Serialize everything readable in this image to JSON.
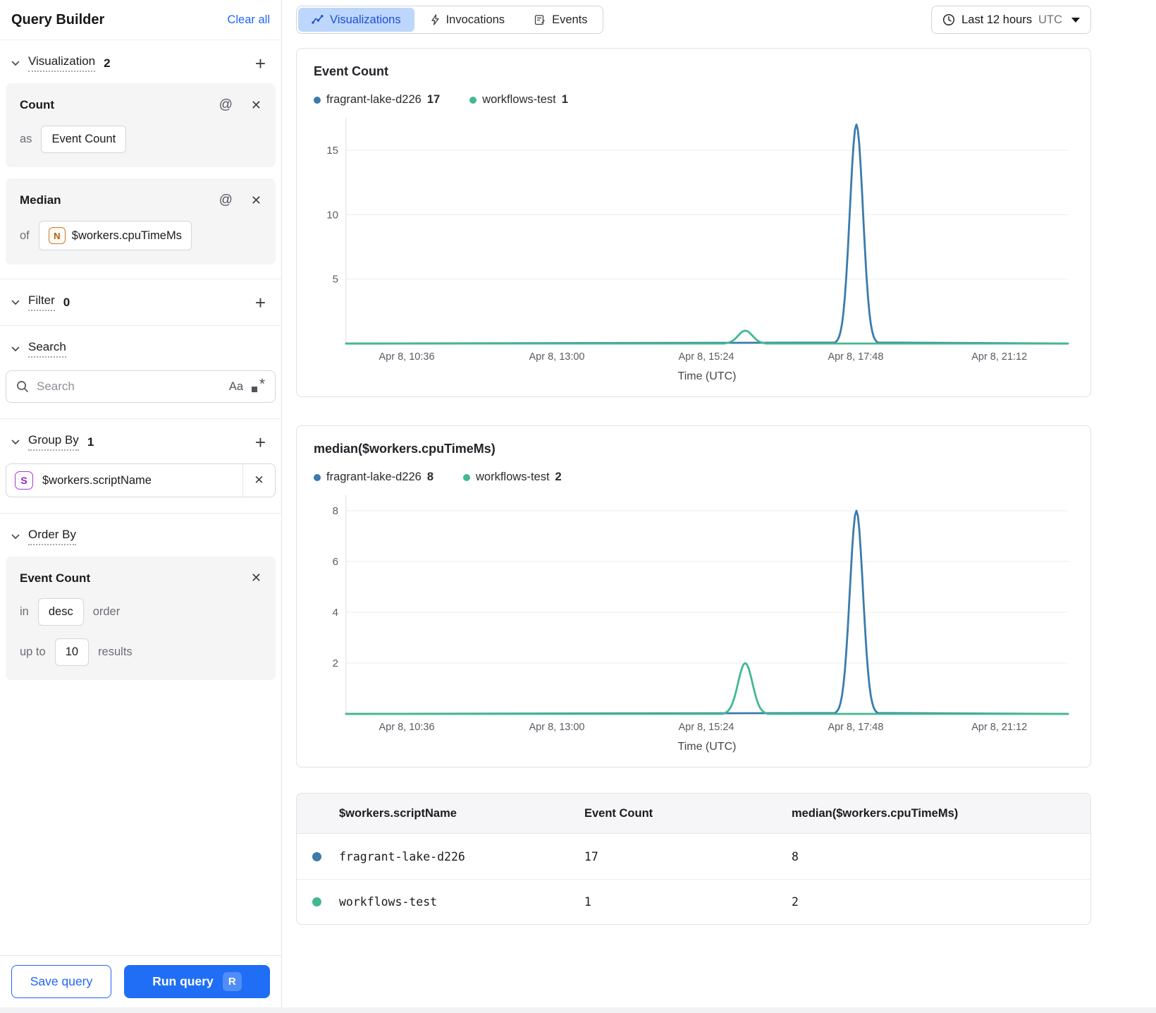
{
  "colors": {
    "accent": "#2166f3",
    "series_blue": "#3b7bad",
    "series_green": "#42b98f",
    "tab_selected_bg": "#bcd7fb",
    "tab_selected_text": "#1d4fd7"
  },
  "sidebar": {
    "title": "Query Builder",
    "clear_all": "Clear all",
    "visualization": {
      "label": "Visualization",
      "count": "2",
      "cards": [
        {
          "title": "Count",
          "prefix": "as",
          "chip": "Event Count"
        },
        {
          "title": "Median",
          "prefix": "of",
          "chip_icon": "N",
          "chip": "$workers.cpuTimeMs"
        }
      ]
    },
    "filter": {
      "label": "Filter",
      "count": "0"
    },
    "search": {
      "label": "Search",
      "placeholder": "Search",
      "case_toggle": "Aa"
    },
    "group_by": {
      "label": "Group By",
      "count": "1",
      "items": [
        {
          "icon": "S",
          "label": "$workers.scriptName"
        }
      ]
    },
    "order_by": {
      "label": "Order By",
      "field": "Event Count",
      "in_label": "in",
      "direction": "desc",
      "order_label": "order",
      "up_to_label": "up to",
      "limit": "10",
      "results_label": "results"
    },
    "save_button": "Save query",
    "run_button": "Run query",
    "run_shortcut": "R"
  },
  "header": {
    "tabs": [
      {
        "label": "Visualizations",
        "selected": true
      },
      {
        "label": "Invocations",
        "selected": false
      },
      {
        "label": "Events",
        "selected": false
      }
    ],
    "time_range": "Last 12 hours",
    "timezone": "UTC"
  },
  "chart_data": [
    {
      "type": "line",
      "title": "Event Count",
      "xlabel": "Time (UTC)",
      "legend": [
        {
          "name": "fragrant-lake-d226",
          "value": "17"
        },
        {
          "name": "workflows-test",
          "value": "1"
        }
      ],
      "yticks": [
        5,
        10,
        15
      ],
      "ylim": [
        0,
        17.3
      ],
      "xticks": [
        "Apr 8, 10:36",
        "Apr 8, 13:00",
        "Apr 8, 15:24",
        "Apr 8, 17:48",
        "Apr 8, 21:12"
      ],
      "xtick_pos": [
        0.084,
        0.292,
        0.499,
        0.706,
        0.905
      ],
      "grid": true,
      "legend_position": "top",
      "series": [
        {
          "name": "fragrant-lake-d226",
          "color": "#3b7bad",
          "baseline": 0,
          "peaks": [
            {
              "x": 0.707,
              "y": 17,
              "halfwidth": 0.02
            }
          ]
        },
        {
          "name": "workflows-test",
          "color": "#42b98f",
          "baseline": 0,
          "peaks": [
            {
              "x": 0.553,
              "y": 1,
              "halfwidth": 0.022
            }
          ]
        }
      ]
    },
    {
      "type": "line",
      "title": "median($workers.cpuTimeMs)",
      "xlabel": "Time (UTC)",
      "legend": [
        {
          "name": "fragrant-lake-d226",
          "value": "8"
        },
        {
          "name": "workflows-test",
          "value": "2"
        }
      ],
      "yticks": [
        2,
        4,
        6,
        8
      ],
      "ylim": [
        0,
        8.5
      ],
      "xticks": [
        "Apr 8, 10:36",
        "Apr 8, 13:00",
        "Apr 8, 15:24",
        "Apr 8, 17:48",
        "Apr 8, 21:12"
      ],
      "xtick_pos": [
        0.084,
        0.292,
        0.499,
        0.706,
        0.905
      ],
      "grid": true,
      "legend_position": "top",
      "series": [
        {
          "name": "fragrant-lake-d226",
          "color": "#3b7bad",
          "baseline": 0,
          "peaks": [
            {
              "x": 0.707,
              "y": 8,
              "halfwidth": 0.02
            }
          ]
        },
        {
          "name": "workflows-test",
          "color": "#42b98f",
          "baseline": 0,
          "peaks": [
            {
              "x": 0.553,
              "y": 2,
              "halfwidth": 0.022
            }
          ]
        }
      ]
    }
  ],
  "table": {
    "columns": [
      "$workers.scriptName",
      "Event Count",
      "median($workers.cpuTimeMs)"
    ],
    "rows": [
      {
        "dot": "#3b7bad",
        "name": "fragrant-lake-d226",
        "event_count": "17",
        "median": "8"
      },
      {
        "dot": "#42b98f",
        "name": "workflows-test",
        "event_count": "1",
        "median": "2"
      }
    ]
  }
}
